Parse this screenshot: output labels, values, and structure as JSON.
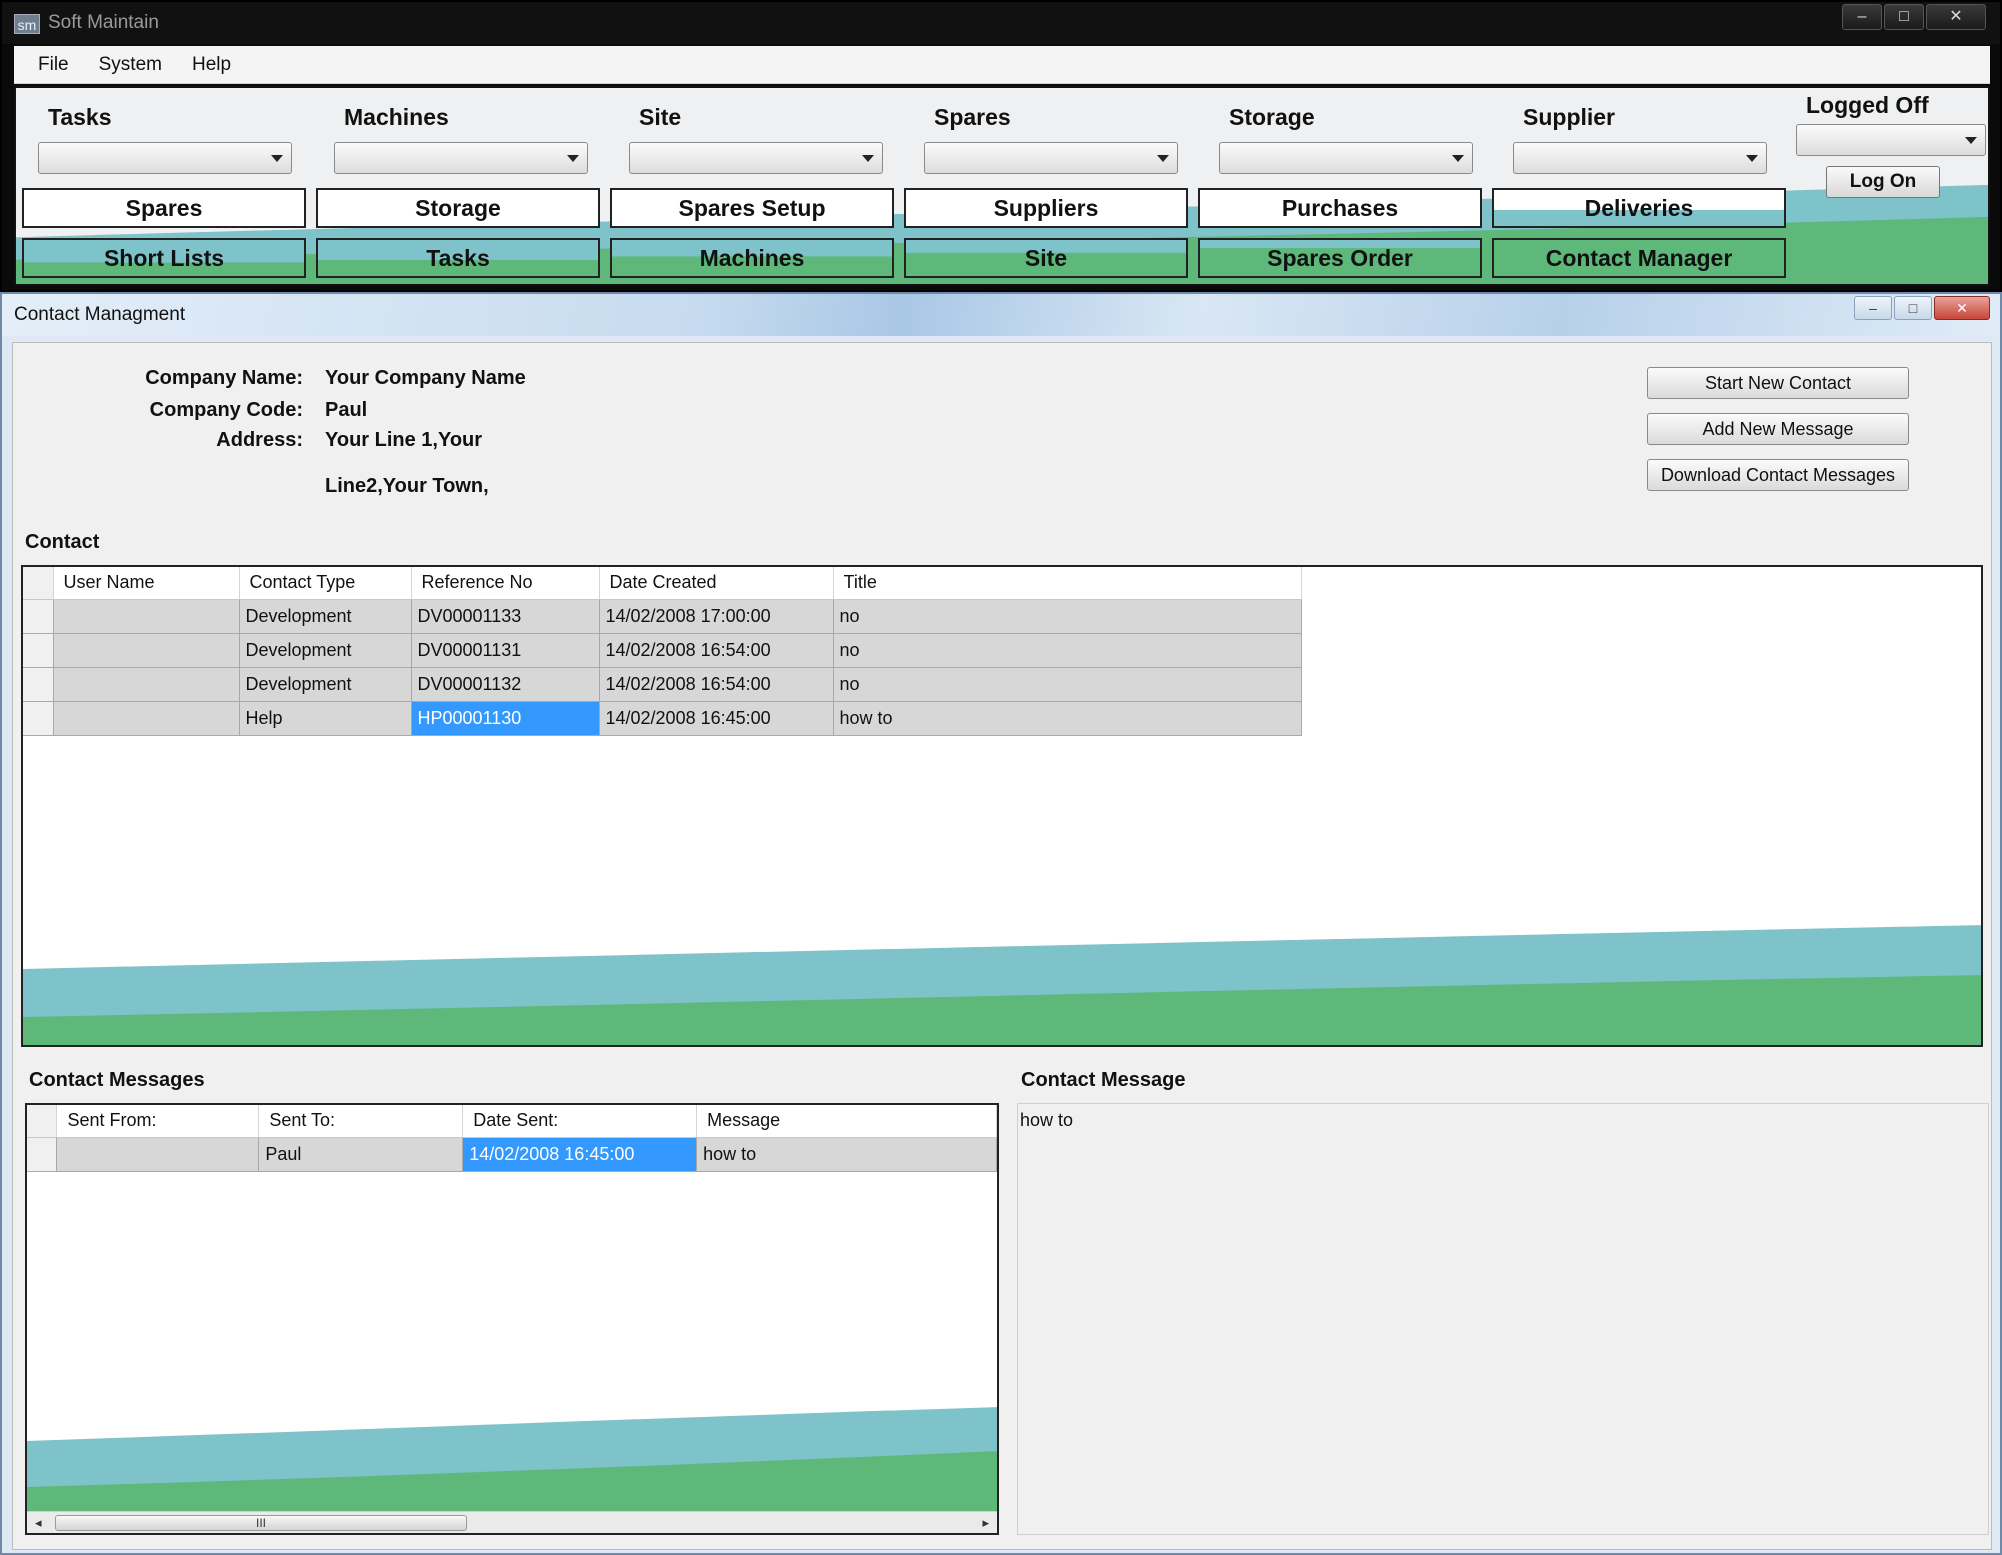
{
  "app": {
    "title": "Soft Maintain",
    "logo": "sm",
    "controls": [
      "–",
      "□",
      "✕"
    ]
  },
  "menu": {
    "items": [
      "File",
      "System",
      "Help"
    ]
  },
  "toolbar": {
    "combos": [
      "Tasks",
      "Machines",
      "Site",
      "Spares",
      "Storage",
      "Supplier"
    ],
    "row1": [
      "Spares",
      "Storage",
      "Spares Setup",
      "Suppliers",
      "Purchases",
      "Deliveries"
    ],
    "row2": [
      "Short Lists",
      "Tasks",
      "Machines",
      "Site",
      "Spares Order",
      "Contact Manager"
    ],
    "status_label": "Logged Off",
    "logon": "Log On"
  },
  "colors": {
    "teal": "#7ec2ca",
    "green": "#5eb87a",
    "selection": "#3399ff"
  },
  "child": {
    "title": "Contact Managment",
    "controls": [
      "–",
      "□",
      "✕"
    ],
    "company": {
      "name_label": "Company Name:",
      "name": "Your Company Name",
      "code_label": "Company Code:",
      "code": "Paul",
      "address_label": "Address:",
      "address_line1": "Your Line 1,Your",
      "address_line2": "Line2,Your Town,"
    },
    "buttons": {
      "start": "Start New Contact",
      "add": "Add New Message",
      "download": "Download Contact Messages"
    },
    "contact": {
      "title": "Contact",
      "columns": [
        "User Name",
        "Contact Type",
        "Reference No",
        "Date Created",
        "Title"
      ],
      "rows": [
        [
          "",
          "Development",
          "DV00001133",
          "14/02/2008 17:00:00",
          "no"
        ],
        [
          "",
          "Development",
          "DV00001131",
          "14/02/2008 16:54:00",
          "no"
        ],
        [
          "",
          "Development",
          "DV00001132",
          "14/02/2008 16:54:00",
          "no"
        ],
        [
          "",
          "Help",
          "HP00001130",
          "14/02/2008 16:45:00",
          "how to"
        ]
      ]
    },
    "messages": {
      "title": "Contact Messages",
      "columns": [
        "Sent From:",
        "Sent To:",
        "Date Sent:",
        "Message"
      ],
      "rows": [
        [
          "",
          "Paul",
          "14/02/2008 16:45:00",
          "how to"
        ]
      ]
    },
    "message": {
      "title": "Contact Message",
      "text": "how to"
    },
    "scroll": {
      "left": "◂",
      "right": "▸",
      "grip": "III"
    }
  }
}
